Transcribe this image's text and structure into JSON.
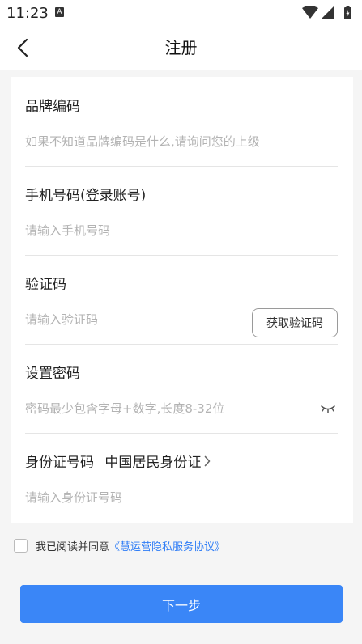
{
  "status_bar": {
    "time": "11:23",
    "notification_icon_letter": "A"
  },
  "nav": {
    "title": "注册",
    "back_icon": "chevron-left-icon"
  },
  "form": {
    "brand_code": {
      "label": "品牌编码",
      "placeholder": "如果不知道品牌编码是什么,请询问您的上级",
      "value": ""
    },
    "phone": {
      "label": "手机号码(登录账号)",
      "placeholder": "请输入手机号码",
      "value": ""
    },
    "verify_code": {
      "label": "验证码",
      "placeholder": "请输入验证码",
      "value": "",
      "button_label": "获取验证码"
    },
    "password": {
      "label": "设置密码",
      "placeholder": "密码最少包含字母+数字,长度8-32位",
      "value": "",
      "toggle_icon": "eye-closed-icon"
    },
    "id_number": {
      "label": "身份证号码",
      "id_type": "中国居民身份证",
      "placeholder": "请输入身份证号码",
      "value": ""
    }
  },
  "agreement": {
    "checked": false,
    "text": "我已阅读并同意",
    "link_text": "《慧运营隐私服务协议》"
  },
  "next_button_label": "下一步",
  "colors": {
    "accent": "#3a86f7",
    "link": "#2f7df6",
    "background": "#f5f5f5"
  }
}
